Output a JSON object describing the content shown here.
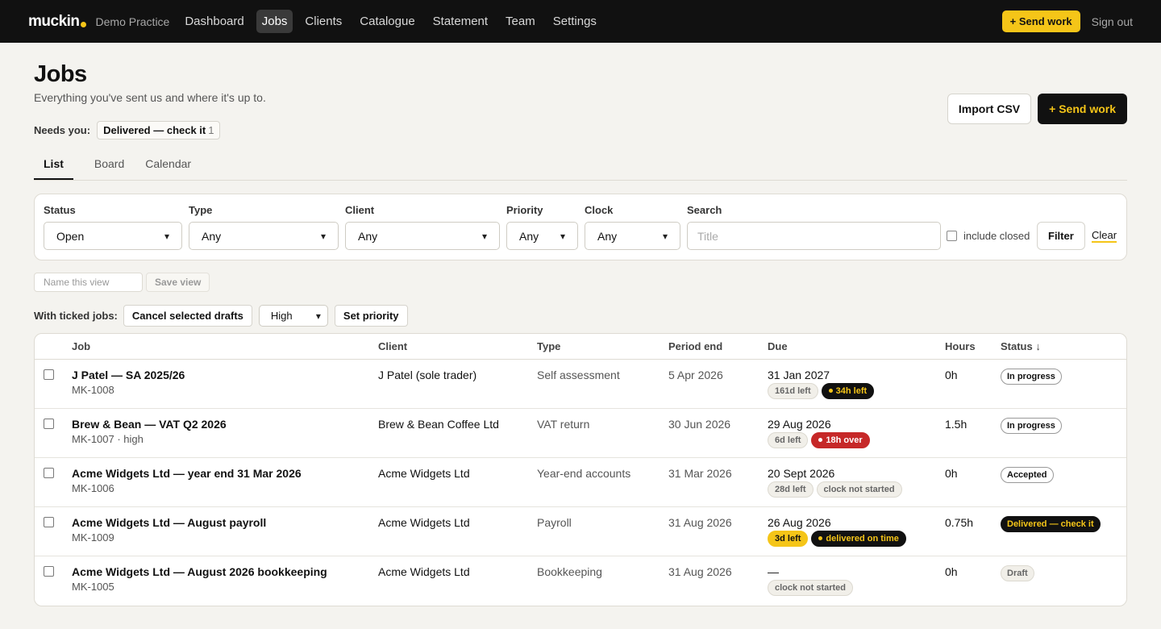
{
  "nav": {
    "logo": "muckin",
    "practice": "Demo Practice",
    "items": [
      "Dashboard",
      "Jobs",
      "Clients",
      "Catalogue",
      "Statement",
      "Team",
      "Settings"
    ],
    "send_work": "+ Send work",
    "sign_out": "Sign out"
  },
  "header": {
    "title": "Jobs",
    "subtitle": "Everything you've sent us and where it's up to.",
    "import_csv": "Import CSV",
    "send_work": "+ Send work"
  },
  "needs": {
    "label": "Needs you:",
    "pill": "Delivered — check it",
    "count": "1"
  },
  "tabs": [
    "List",
    "Board",
    "Calendar"
  ],
  "filters": {
    "status_label": "Status",
    "status_value": "Open",
    "type_label": "Type",
    "type_value": "Any",
    "client_label": "Client",
    "client_value": "Any",
    "priority_label": "Priority",
    "priority_value": "Any",
    "clock_label": "Clock",
    "clock_value": "Any",
    "search_label": "Search",
    "search_placeholder": "Title",
    "include_closed": "include closed",
    "filter_button": "Filter",
    "clear": "Clear"
  },
  "saved_view": {
    "placeholder": "Name this view",
    "save_button": "Save view"
  },
  "bulk": {
    "label": "With ticked jobs:",
    "cancel_button": "Cancel selected drafts",
    "priority_value": "High",
    "set_priority": "Set priority"
  },
  "table": {
    "headers": {
      "job": "Job",
      "client": "Client",
      "type": "Type",
      "period_end": "Period end",
      "due": "Due",
      "hours": "Hours",
      "status": "Status ↓"
    },
    "rows": [
      {
        "title": "J Patel — SA 2025/26",
        "meta": "MK-1008",
        "client": "J Patel (sole trader)",
        "type": "Self assessment",
        "period_end": "5 Apr 2026",
        "due": "31 Jan 2027",
        "chip1": "161d left",
        "chip2": "34h left",
        "hours": "0h",
        "status": "In progress"
      },
      {
        "title": "Brew & Bean — VAT Q2 2026",
        "meta": "MK-1007 · high",
        "client": "Brew & Bean Coffee Ltd",
        "type": "VAT return",
        "period_end": "30 Jun 2026",
        "due": "29 Aug 2026",
        "chip1": "6d left",
        "chip2": "18h over",
        "hours": "1.5h",
        "status": "In progress"
      },
      {
        "title": "Acme Widgets Ltd — year end 31 Mar 2026",
        "meta": "MK-1006",
        "client": "Acme Widgets Ltd",
        "type": "Year-end accounts",
        "period_end": "31 Mar 2026",
        "due": "20 Sept 2026",
        "chip1": "28d left",
        "chip2": "clock not started",
        "hours": "0h",
        "status": "Accepted"
      },
      {
        "title": "Acme Widgets Ltd — August payroll",
        "meta": "MK-1009",
        "client": "Acme Widgets Ltd",
        "type": "Payroll",
        "period_end": "31 Aug 2026",
        "due": "26 Aug 2026",
        "chip1": "3d left",
        "chip2": "delivered on time",
        "hours": "0.75h",
        "status": "Delivered — check it"
      },
      {
        "title": "Acme Widgets Ltd — August 2026 bookkeeping",
        "meta": "MK-1005",
        "client": "Acme Widgets Ltd",
        "type": "Bookkeeping",
        "period_end": "31 Aug 2026",
        "due": "—",
        "chip1": "clock not started",
        "hours": "0h",
        "status": "Draft"
      }
    ]
  },
  "colors": {
    "brand_yellow": "#f5c518",
    "nav_bg": "#111111",
    "overdue_red": "#c62828"
  }
}
